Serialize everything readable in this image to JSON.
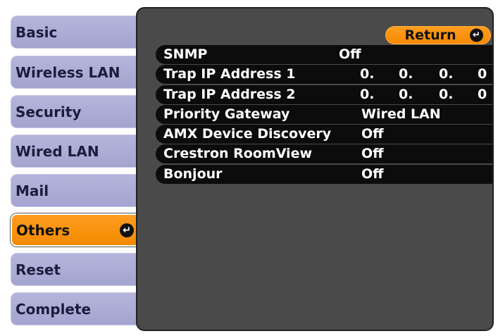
{
  "sidebar": {
    "items": [
      {
        "label": "Basic"
      },
      {
        "label": "Wireless LAN"
      },
      {
        "label": "Security"
      },
      {
        "label": "Wired LAN"
      },
      {
        "label": "Mail"
      },
      {
        "label": "Others",
        "active": true,
        "icon": "enter-icon"
      },
      {
        "label": "Reset"
      },
      {
        "label": "Complete"
      }
    ]
  },
  "main": {
    "return_label": "Return",
    "return_icon": "enter-icon",
    "rows": [
      {
        "label": "SNMP",
        "value": "Off"
      },
      {
        "label": "Trap IP Address 1",
        "ip": [
          "0.",
          "0.",
          "0.",
          "0"
        ]
      },
      {
        "label": "Trap IP Address 2",
        "ip": [
          "0.",
          "0.",
          "0.",
          "0"
        ]
      },
      {
        "label": "Priority Gateway",
        "value": "Wired LAN"
      },
      {
        "label": "AMX Device Discovery",
        "value": "Off"
      },
      {
        "label": "Crestron RoomView",
        "value": "Off"
      },
      {
        "label": "Bonjour",
        "value": "Off"
      }
    ]
  },
  "colors": {
    "accent": "#f58a00",
    "sidebar_item": "#a8a8d2",
    "panel": "#4a4a4a",
    "row": "#0c0c0c"
  }
}
